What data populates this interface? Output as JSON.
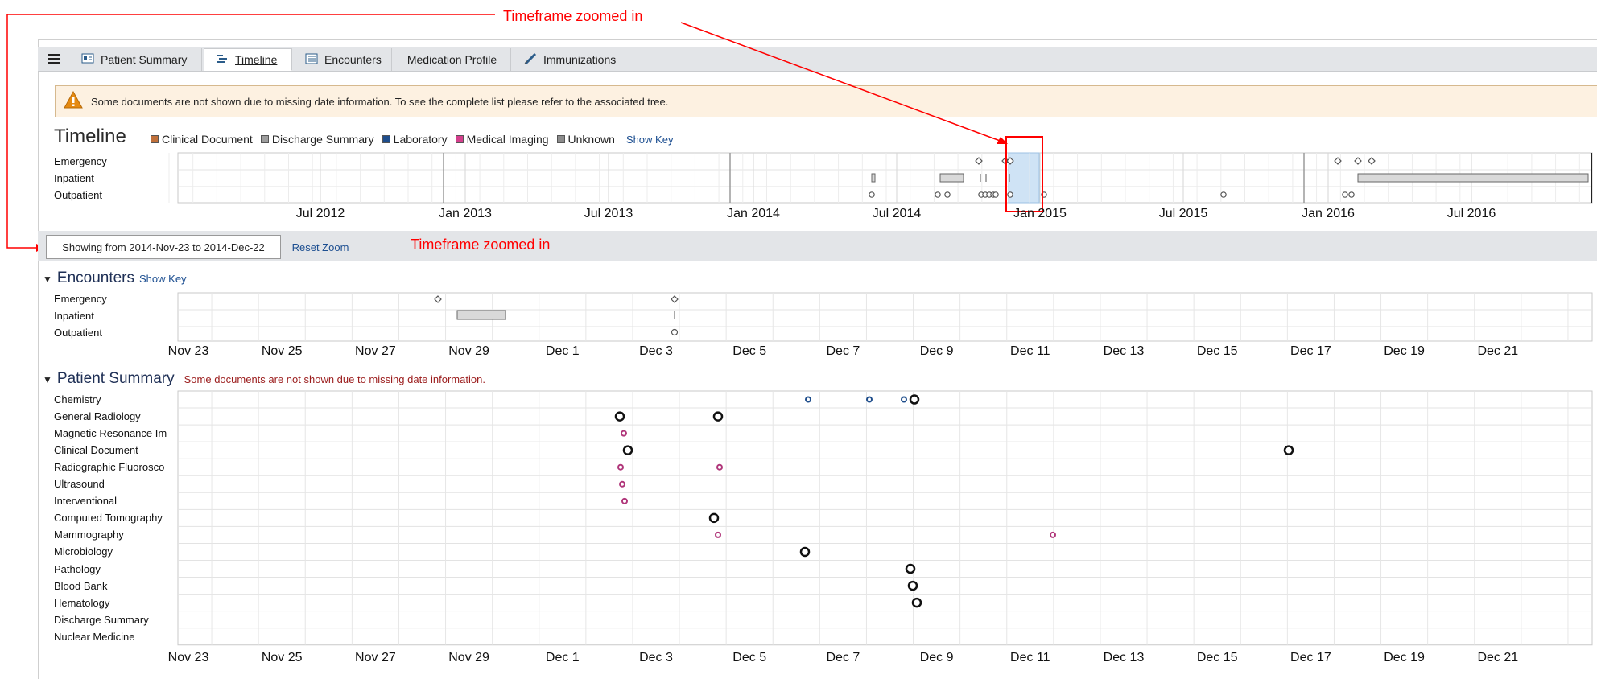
{
  "tabs": [
    {
      "label": "Patient Summary",
      "icon": "patient-summary-icon"
    },
    {
      "label": "Timeline",
      "icon": "timeline-icon",
      "active": true
    },
    {
      "label": "Encounters",
      "icon": "encounters-icon"
    },
    {
      "label": "Medication Profile"
    },
    {
      "label": "Immunizations",
      "icon": "syringe-icon"
    }
  ],
  "warning": {
    "text": "Some documents are not shown due to missing date information. To see the complete list please refer to the associated tree."
  },
  "timeline": {
    "title": "Timeline",
    "legend": [
      {
        "label": "Clinical Document",
        "color": "#c0703a"
      },
      {
        "label": "Discharge Summary",
        "color": "#9e9e9e"
      },
      {
        "label": "Laboratory",
        "color": "#1f4e8c"
      },
      {
        "label": "Medical Imaging",
        "color": "#d43f8d"
      },
      {
        "label": "Unknown",
        "color": "#8c8c8c"
      }
    ],
    "show_key": "Show Key",
    "rows": [
      "Emergency",
      "Inpatient",
      "Outpatient"
    ],
    "axis": [
      "Jul 2012",
      "Jan 2013",
      "Jul 2013",
      "Jan 2014",
      "Jul 2014",
      "Jan 2015",
      "Jul 2015",
      "Jan 2016",
      "Jul 2016"
    ]
  },
  "zoom": {
    "showing": "Showing from 2014-Nov-23 to 2014-Dec-22",
    "reset": "Reset Zoom"
  },
  "annotations": {
    "top": "Timeframe zoomed in",
    "middle": "Timeframe zoomed in"
  },
  "encounters": {
    "title": "Encounters",
    "show_key": "Show Key",
    "rows": [
      "Emergency",
      "Inpatient",
      "Outpatient"
    ],
    "axis": [
      "Nov 23",
      "Nov 25",
      "Nov 27",
      "Nov 29",
      "Dec 1",
      "Dec 3",
      "Dec 5",
      "Dec 7",
      "Dec 9",
      "Dec 11",
      "Dec 13",
      "Dec 15",
      "Dec 17",
      "Dec 19",
      "Dec 21"
    ]
  },
  "patient_summary": {
    "title": "Patient Summary",
    "message": "Some documents are not shown due to missing date information.",
    "rows": [
      "Chemistry",
      "General Radiology",
      "Magnetic Resonance Im",
      "Clinical Document",
      "Radiographic Fluorosco",
      "Ultrasound",
      "Interventional",
      "Computed Tomography",
      "Mammography",
      "Microbiology",
      "Pathology",
      "Blood Bank",
      "Hematology",
      "Discharge Summary",
      "Nuclear Medicine"
    ],
    "axis": [
      "Nov 23",
      "Nov 25",
      "Nov 27",
      "Nov 29",
      "Dec 1",
      "Dec 3",
      "Dec 5",
      "Dec 7",
      "Dec 9",
      "Dec 11",
      "Dec 13",
      "Dec 15",
      "Dec 17",
      "Dec 19",
      "Dec 21"
    ]
  }
}
